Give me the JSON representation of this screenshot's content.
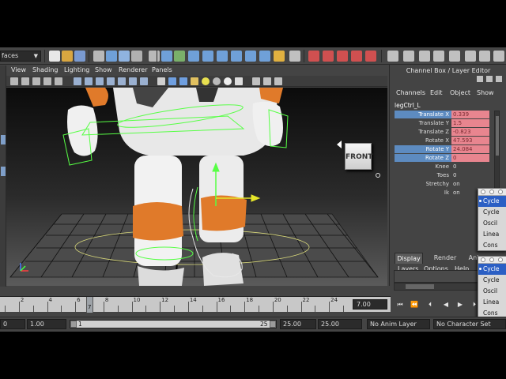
{
  "shelf": {
    "mode_dropdown": "faces"
  },
  "viewport": {
    "menu": [
      "View",
      "Shading",
      "Lighting",
      "Show",
      "Renderer",
      "Panels"
    ],
    "view_label": "FRONT"
  },
  "channel_box": {
    "title": "Channel Box / Layer Editor",
    "menu": [
      "Channels",
      "Edit",
      "Object",
      "Show"
    ],
    "node_name": "legCtrl_L",
    "attributes": [
      {
        "label": "Translate X",
        "value": "0.339",
        "selected": true,
        "keyed": true
      },
      {
        "label": "Translate Y",
        "value": "1.5",
        "selected": false,
        "keyed": true
      },
      {
        "label": "Translate Z",
        "value": "-0.823",
        "selected": false,
        "keyed": true
      },
      {
        "label": "Rotate X",
        "value": "47.593",
        "selected": false,
        "keyed": true
      },
      {
        "label": "Rotate Y",
        "value": "24.084",
        "selected": true,
        "keyed": true
      },
      {
        "label": "Rotate Z",
        "value": "0",
        "selected": true,
        "keyed": true
      },
      {
        "label": "Knee",
        "value": "0",
        "selected": false,
        "keyed": false
      },
      {
        "label": "Toes",
        "value": "0",
        "selected": false,
        "keyed": false
      },
      {
        "label": "Stretchy",
        "value": "on",
        "selected": false,
        "keyed": false
      },
      {
        "label": "Ik",
        "value": "on",
        "selected": false,
        "keyed": false
      }
    ]
  },
  "layer_editor": {
    "tabs": [
      "Display",
      "Render",
      "Ani"
    ],
    "active_tab": "Display",
    "menu": [
      "Layers",
      "Options",
      "Help"
    ]
  },
  "popup_menus": [
    {
      "items": [
        "Cycle",
        "Cycle",
        "Oscil",
        "Linea",
        "Cons"
      ],
      "highlighted": 0
    },
    {
      "items": [
        "Cycle",
        "Cycle",
        "Oscil",
        "Linea",
        "Cons"
      ],
      "highlighted": 0
    }
  ],
  "time_slider": {
    "tick_labels": [
      "2",
      "4",
      "6",
      "8",
      "10",
      "12",
      "14",
      "16",
      "18",
      "20",
      "22",
      "24"
    ],
    "current_frame_marker": "7",
    "current_time": "7.00"
  },
  "range_slider": {
    "start_time": "0",
    "playback_start": "1.00",
    "range_start_label": "1",
    "range_end_label": "25",
    "playback_end": "25.00",
    "end_time": "25.00",
    "anim_layer": "No Anim Layer",
    "character_set": "No Character Set"
  },
  "colors": {
    "selected_attr": "#5d8bc0",
    "keyed_attr": "#e8858f",
    "menu_highlight": "#2b5fc4",
    "character_orange": "#e07a2a",
    "nurbs_green": "#57ff45"
  }
}
